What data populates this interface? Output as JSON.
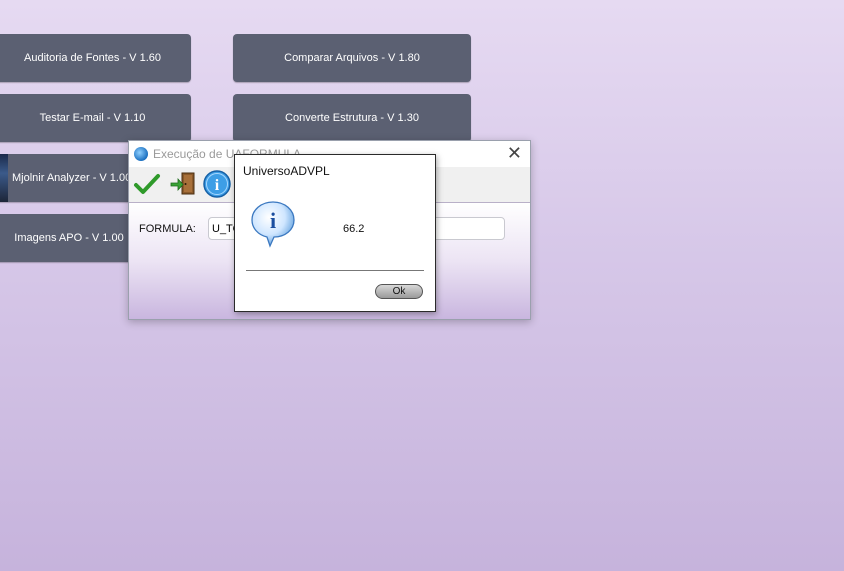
{
  "tools": {
    "auditoria": "Auditoria de Fontes - V 1.60",
    "comparar": "Comparar Arquivos - V 1.80",
    "testar_email": "Testar E-mail - V 1.10",
    "converte": "Converte Estrutura - V 1.30",
    "mjolnir": "Mjolnir Analyzer - V 1.00",
    "imagens": "Imagens APO - V 1.00"
  },
  "formula_window": {
    "title": "Execução de UAFORMULA",
    "close_symbol": "✕",
    "formula_label": "FORMULA:",
    "formula_value": "U_TOTAL"
  },
  "message_dialog": {
    "title": "UniversoADVPL",
    "value": "66.2",
    "ok_label": "Ok"
  },
  "colors": {
    "tool_button": "#5b6072",
    "background_top": "#e6daf2",
    "background_bottom": "#c6b3dc"
  },
  "icons": {
    "confirm": "check-icon",
    "exit": "exit-door-icon",
    "info": "info-icon"
  }
}
